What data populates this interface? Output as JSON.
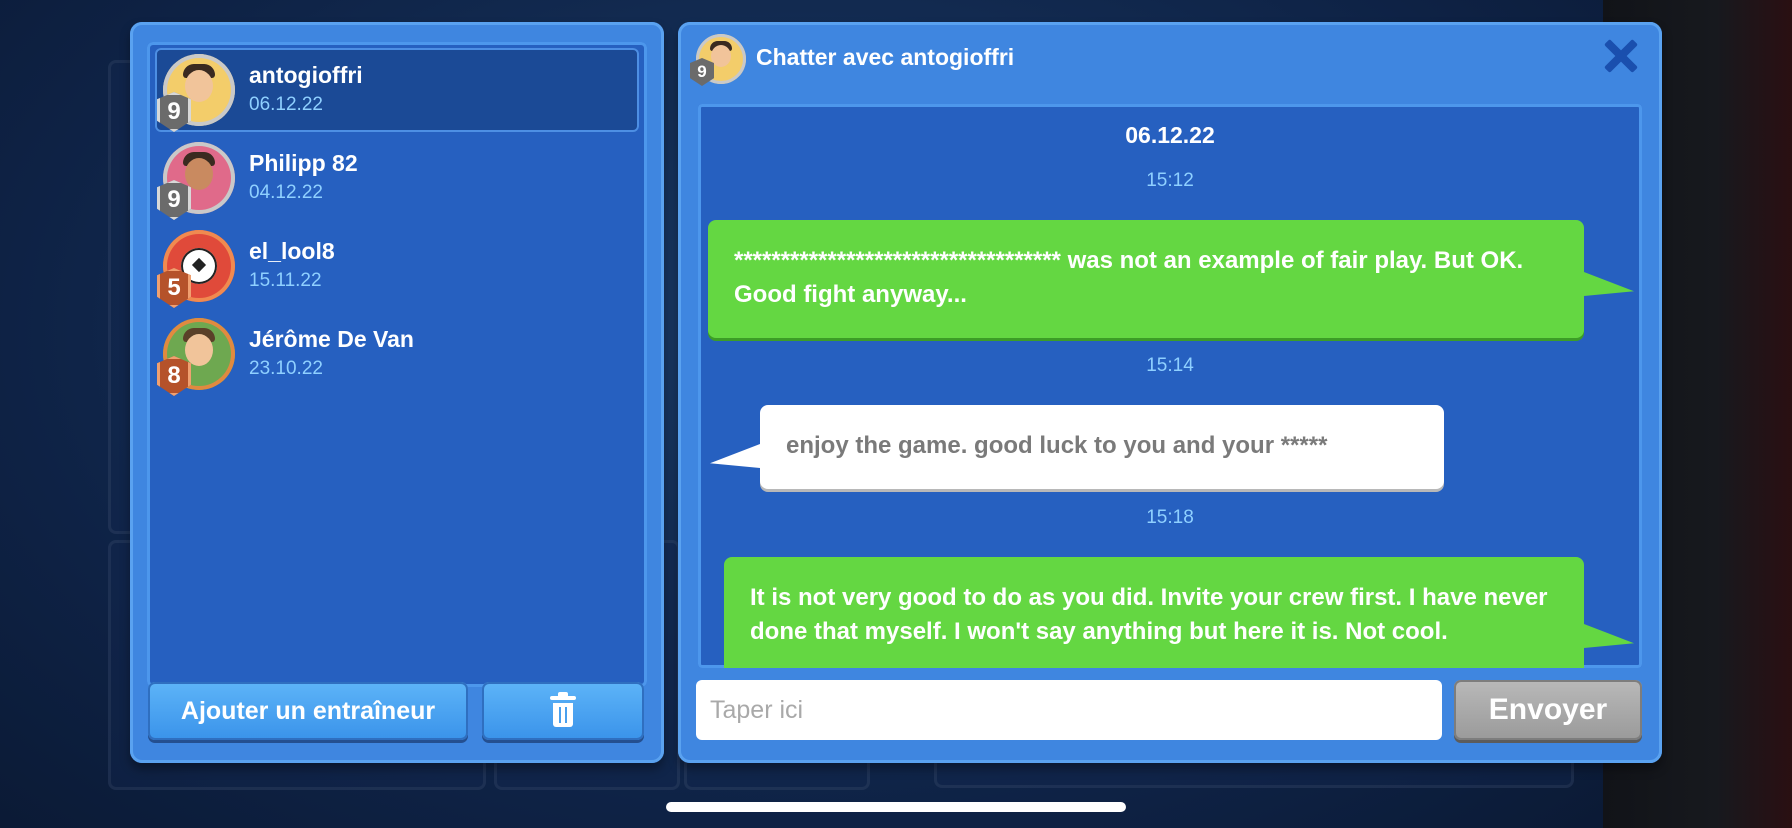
{
  "friends": [
    {
      "name": "antogioffri",
      "date": "06.12.22",
      "level": "9",
      "selected": true
    },
    {
      "name": "Philipp 82",
      "date": "04.12.22",
      "level": "9"
    },
    {
      "name": "el_lool8",
      "date": "15.11.22",
      "level": "5"
    },
    {
      "name": "Jérôme De Van",
      "date": "23.10.22",
      "level": "8"
    }
  ],
  "left_buttons": {
    "add_label": "Ajouter un entraîneur",
    "delete_icon": "trash-icon"
  },
  "chat": {
    "title": "Chatter avec antogioffri",
    "header_level": "9",
    "date": "06.12.22",
    "messages": [
      {
        "time": "15:12",
        "direction": "out",
        "text": "*********************************** was not an example of fair play. But OK. Good fight anyway..."
      },
      {
        "time": "15:14",
        "direction": "in",
        "text": "enjoy the game. good luck to you and your *****"
      },
      {
        "time": "15:18",
        "direction": "out",
        "text": "It is not very good to do as you did. Invite your crew first. I have never done that myself. I won't say anything but here it is. Not cool."
      }
    ],
    "input_placeholder": "Taper ici",
    "send_label": "Envoyer"
  },
  "colors": {
    "panel": "#3f86e0",
    "panel_inner": "#2660c0",
    "out_bubble": "#64d742",
    "in_bubble": "#ffffff",
    "date_text": "#8fd0ff"
  }
}
